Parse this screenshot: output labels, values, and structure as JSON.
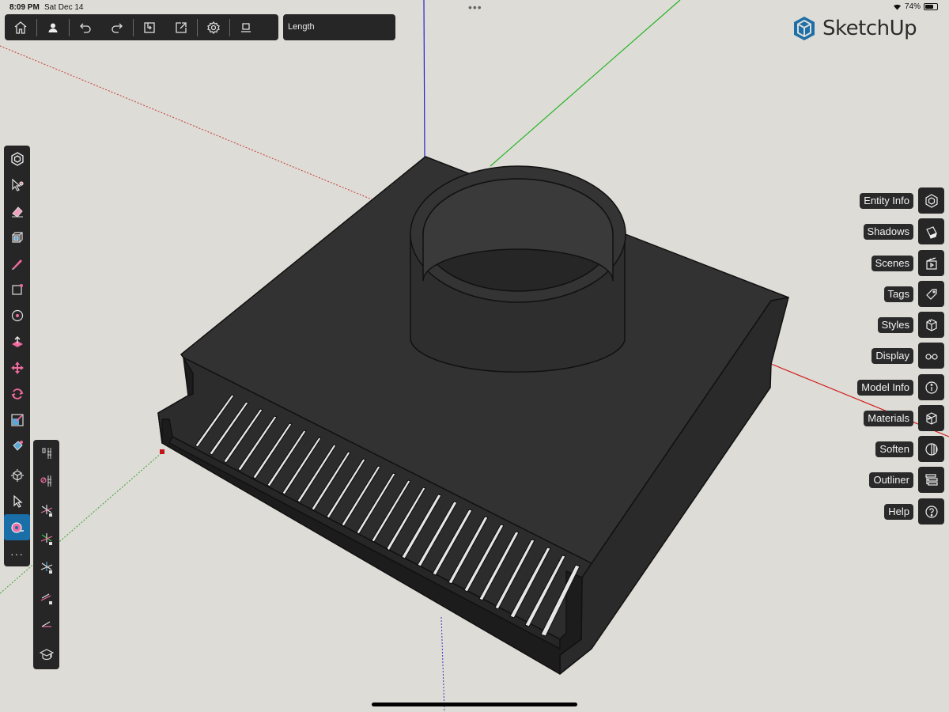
{
  "status_bar": {
    "time": "8:09 PM",
    "date": "Sat Dec 14",
    "multitask": "•••",
    "battery_percent": "74%",
    "battery_level": 0.74
  },
  "top_toolbar": {
    "buttons": [
      "home-icon",
      "profile-icon",
      "undo-icon",
      "redo-icon",
      "import-icon",
      "export-icon",
      "settings-icon",
      "display-mode-icon"
    ]
  },
  "measurements": {
    "label": "Length"
  },
  "brand": {
    "name": "SketchUp",
    "accent": "#1c6fa8"
  },
  "left_toolbar": {
    "tools": [
      "components-icon",
      "select-paint-icon",
      "eraser-icon",
      "box-icon",
      "pencil-icon",
      "rectangle-icon",
      "circle-icon",
      "push-pull-icon",
      "move-icon",
      "rotate-icon",
      "scale-icon",
      "paint-bucket-icon",
      "orbit-icon",
      "select-arrow-icon",
      "tape-measure-icon"
    ],
    "more": "···",
    "active_tool": "tape-measure-icon"
  },
  "sub_toolbar": {
    "tools": [
      "guide-point-icon",
      "delete-guides-icon",
      "axis-lock-red-icon",
      "axis-lock-green-icon",
      "axis-lock-blue-icon",
      "inference-lock-icon",
      "protractor-icon",
      "hat-icon"
    ]
  },
  "right_panels": [
    {
      "label": "Entity Info",
      "icon": "entity-info-icon"
    },
    {
      "label": "Shadows",
      "icon": "shadows-icon"
    },
    {
      "label": "Scenes",
      "icon": "scenes-icon"
    },
    {
      "label": "Tags",
      "icon": "tags-icon"
    },
    {
      "label": "Styles",
      "icon": "styles-icon"
    },
    {
      "label": "Display",
      "icon": "display-icon"
    },
    {
      "label": "Model Info",
      "icon": "model-info-icon"
    },
    {
      "label": "Materials",
      "icon": "materials-icon"
    },
    {
      "label": "Soften",
      "icon": "soften-icon"
    },
    {
      "label": "Outliner",
      "icon": "outliner-icon"
    },
    {
      "label": "Help",
      "icon": "help-icon"
    }
  ],
  "colors": {
    "background": "#dedcd6",
    "toolbar": "#262626",
    "model": "#2f2f2f",
    "axis_red": "#d21c1c",
    "axis_green": "#22b322",
    "axis_blue": "#2222cc",
    "active_tool": "#1a6fa8"
  }
}
